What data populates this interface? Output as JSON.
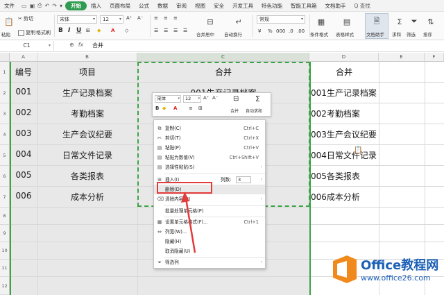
{
  "menubar": {
    "file": "文件",
    "tabs": [
      "开始",
      "插入",
      "页面布局",
      "公式",
      "数据",
      "审阅",
      "视图",
      "安全",
      "开发工具",
      "特色功能",
      "智能工具箱",
      "文档助手"
    ],
    "active_tab": "开始",
    "search": "Q 查找"
  },
  "ribbon": {
    "cut": "剪切",
    "paste": "粘贴",
    "copy": "复制",
    "format_painter": "格式刷",
    "font_name": "宋体",
    "font_size": "12",
    "merge_center": "合并居中",
    "wrap_text": "自动换行",
    "number_format": "常规",
    "conditional_format": "条件格式",
    "table_style": "表格样式",
    "doc_assistant": "文档助手",
    "sum": "求和",
    "filter": "筛选",
    "sort": "排序"
  },
  "formulabar": {
    "cell_ref": "C1",
    "fx": "fx",
    "content": "合并"
  },
  "grid": {
    "columns": [
      "A",
      "B",
      "C",
      "D",
      "E",
      "F"
    ],
    "rows": [
      "1",
      "2",
      "3",
      "4",
      "5",
      "6",
      "7",
      "8",
      "9",
      "10",
      "11",
      "12"
    ],
    "header": {
      "A": "编号",
      "B": "项目",
      "C": "合并",
      "D": "合并"
    },
    "data": [
      {
        "A": "001",
        "B": "生产记录档案",
        "D": "001生产记录档案"
      },
      {
        "A": "002",
        "B": "考勤档案",
        "D": "002考勤档案"
      },
      {
        "A": "003",
        "B": "生产会议纪要",
        "D": "003生产会议纪要"
      },
      {
        "A": "004",
        "B": "日常文件记录",
        "D": "004日常文件记录"
      },
      {
        "A": "005",
        "B": "各类报表",
        "D": "005各类报表"
      },
      {
        "A": "006",
        "B": "成本分析",
        "D": "006成本分析"
      }
    ],
    "c_partial": [
      "001生产记录档案",
      "002考勤档案"
    ]
  },
  "mini_toolbar": {
    "font": "宋体",
    "size": "12",
    "merge": "合并",
    "autosum": "自动求和"
  },
  "context_menu": {
    "items": [
      {
        "label": "复制(C)",
        "shortcut": "Ctrl+C"
      },
      {
        "label": "剪切(T)",
        "shortcut": "Ctrl+X"
      },
      {
        "label": "粘贴(P)",
        "shortcut": "Ctrl+V"
      },
      {
        "label": "粘贴为数值(V)",
        "shortcut": "Ctrl+Shift+V"
      },
      {
        "label": "选择性粘贴(S)",
        "shortcut": ""
      },
      {
        "label": "插入(I)",
        "shortcut": ""
      },
      {
        "label": "删除(D)",
        "shortcut": ""
      },
      {
        "label": "清除内容(N)",
        "shortcut": ""
      },
      {
        "label": "批量处理单元格(P)",
        "shortcut": ""
      },
      {
        "label": "设置单元格格式(F)...",
        "shortcut": "Ctrl+1"
      },
      {
        "label": "列宽(W)...",
        "shortcut": ""
      },
      {
        "label": "隐藏(H)",
        "shortcut": ""
      },
      {
        "label": "取消隐藏(U)",
        "shortcut": ""
      },
      {
        "label": "筛选列",
        "shortcut": ""
      }
    ],
    "columns_label": "列数:",
    "columns_value": "3"
  },
  "watermark": {
    "brand": "Office教程网",
    "url": "www.office26.com"
  },
  "colors": {
    "accent_green": "#2e9b4f",
    "selection_border": "#3aa445",
    "highlight_red": "#e33b3b",
    "watermark_blue": "#1b5fb6",
    "watermark_orange": "#f08a1c"
  }
}
